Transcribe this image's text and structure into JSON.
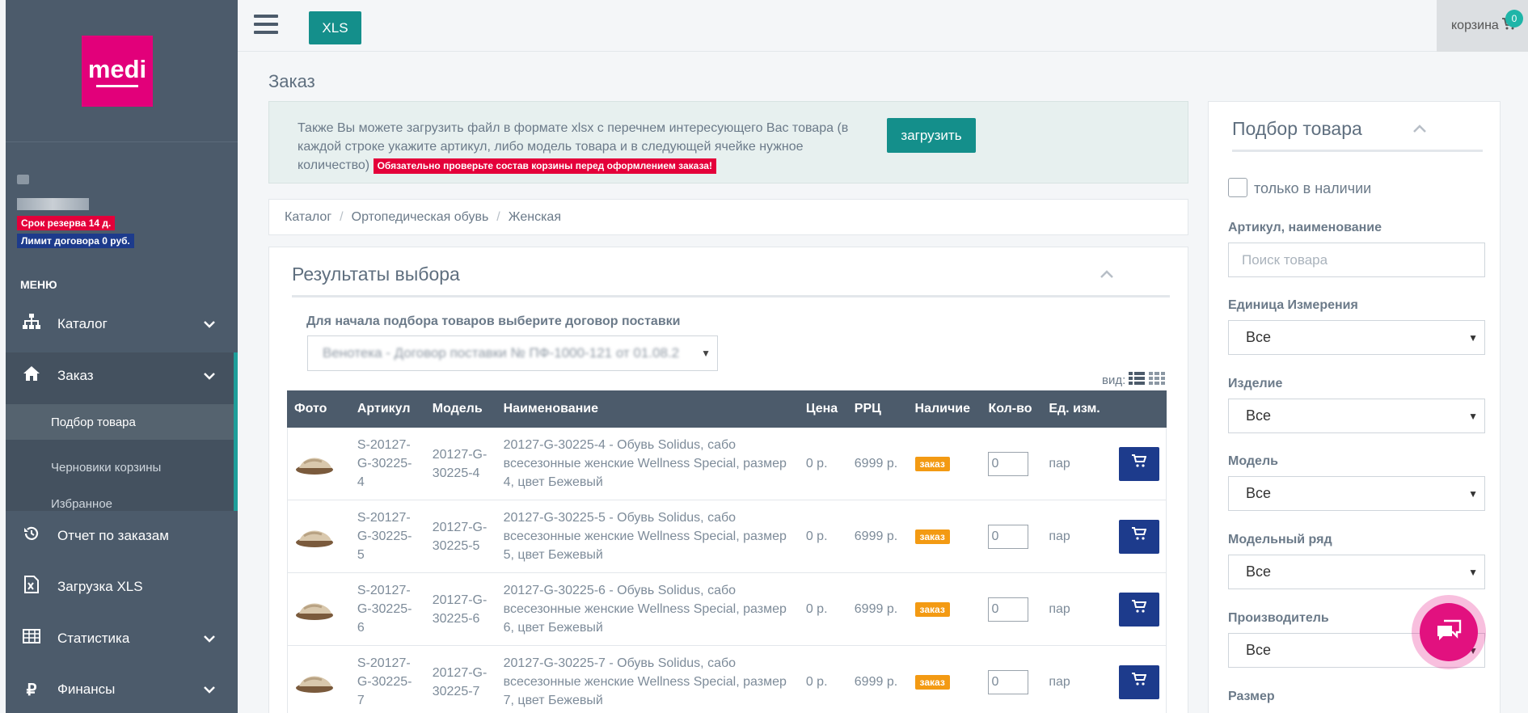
{
  "sidebar": {
    "logo_text": "medi",
    "user_name_obscured": "",
    "reserve_badge": "Срок резерва 14 д.",
    "limit_badge": "Лимит договора 0 руб.",
    "menu_heading": "МЕНЮ",
    "items": [
      {
        "label": "Каталог",
        "icon": "sitemap-icon",
        "has_chevron": true
      },
      {
        "label": "Заказ",
        "icon": "home-icon",
        "has_chevron": true
      },
      {
        "label": "Отчет по заказам",
        "icon": "history-icon",
        "has_chevron": false
      },
      {
        "label": "Загрузка XLS",
        "icon": "excel-file-icon",
        "has_chevron": false
      },
      {
        "label": "Статистика",
        "icon": "table-grid-icon",
        "has_chevron": true
      },
      {
        "label": "Финансы",
        "icon": "ruble-icon",
        "has_chevron": true
      }
    ],
    "subitems": [
      "Подбор товара",
      "Черновики корзины",
      "Избранное"
    ],
    "colors": {
      "bg": "#4c5b6b",
      "accent": "#1e9e9a",
      "brand": "#e2007a"
    }
  },
  "topbar": {
    "xls_label": "XLS",
    "cart_label": "корзина",
    "cart_count": "0"
  },
  "page": {
    "title": "Заказ",
    "info_text": "Также Вы можете загрузить файл в формате xlsx с перечнем интересующего Вас товара (в каждой строке укажите артикул, либо модель товара и в следующей ячейке нужное количество)",
    "warning": "Обязательно проверьте состав корзины перед оформлением заказа!",
    "upload_label": "загрузить"
  },
  "breadcrumb": [
    "Каталог",
    "Ортопедическая обувь",
    "Женская"
  ],
  "results": {
    "title": "Результаты выбора",
    "contract_label": "Для начала подбора товаров выберите договор поставки",
    "contract_value": "Венотека - Договор поставки № ПФ-1000-121 от 01.08.2",
    "view_label": "вид:",
    "columns": [
      "Фото",
      "Артикул",
      "Модель",
      "Наименование",
      "Цена",
      "РРЦ",
      "Наличие",
      "Кол-во",
      "Ед. изм.",
      ""
    ],
    "rows": [
      {
        "article": "S-20127-G-30225-4",
        "model": "20127-G-30225-4",
        "name": "20127-G-30225-4 - Обувь Solidus, сабо всесезонные женские Wellness Special, размер 4, цвет Бежевый",
        "price": "0 р.",
        "rrp": "6999 р.",
        "stock": "заказ",
        "qty": "0",
        "unit": "пар"
      },
      {
        "article": "S-20127-G-30225-5",
        "model": "20127-G-30225-5",
        "name": "20127-G-30225-5 - Обувь Solidus, сабо всесезонные женские Wellness Special, размер 5, цвет Бежевый",
        "price": "0 р.",
        "rrp": "6999 р.",
        "stock": "заказ",
        "qty": "0",
        "unit": "пар"
      },
      {
        "article": "S-20127-G-30225-6",
        "model": "20127-G-30225-6",
        "name": "20127-G-30225-6 - Обувь Solidus, сабо всесезонные женские Wellness Special, размер 6, цвет Бежевый",
        "price": "0 р.",
        "rrp": "6999 р.",
        "stock": "заказ",
        "qty": "0",
        "unit": "пар"
      },
      {
        "article": "S-20127-G-30225-7",
        "model": "20127-G-30225-7",
        "name": "20127-G-30225-7 - Обувь Solidus, сабо всесезонные женские Wellness Special, размер 7, цвет Бежевый",
        "price": "0 р.",
        "rrp": "6999 р.",
        "stock": "заказ",
        "qty": "0",
        "unit": "пар"
      }
    ]
  },
  "filter": {
    "title": "Подбор товара",
    "in_stock_label": "только в наличии",
    "search_label": "Артикул, наименование",
    "search_placeholder": "Поиск товара",
    "selects": [
      {
        "label": "Единица Измерения",
        "value": "Все"
      },
      {
        "label": "Изделие",
        "value": "Все"
      },
      {
        "label": "Модель",
        "value": "Все"
      },
      {
        "label": "Модельный ряд",
        "value": "Все"
      },
      {
        "label": "Производитель",
        "value": "Все"
      }
    ],
    "last_label": "Размер"
  }
}
